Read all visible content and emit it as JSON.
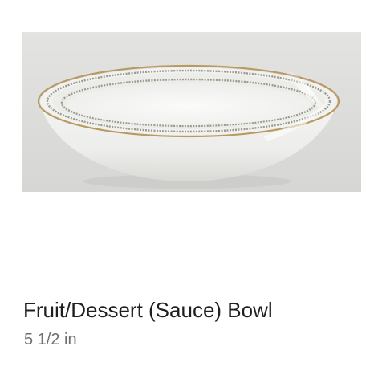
{
  "product": {
    "title": "Fruit/Dessert (Sauce) Bowl",
    "size": "5 1/2 in",
    "image_icon": "porcelain-bowl-photo"
  },
  "colors": {
    "title_text": "#1f1f1f",
    "size_text": "#6f6f6f",
    "photo_background": "#dcdcda",
    "gold_rim": "#b99a63",
    "platinum_band": "#9a9a8e"
  }
}
